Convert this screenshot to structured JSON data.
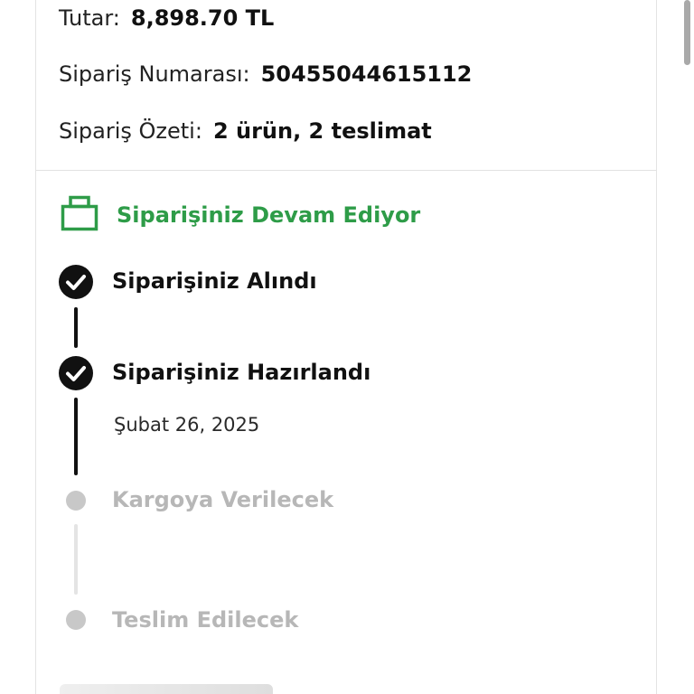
{
  "order": {
    "amount_label": "Tutar:",
    "amount_value": "8,898.70 TL",
    "number_label": "Sipariş Numarası:",
    "number_value": "50455044615112",
    "summary_label": "Sipariş Özeti:",
    "summary_value": "2 ürün, 2 teslimat"
  },
  "status": {
    "title": "Siparişiniz Devam Ediyor",
    "icon": "package-box-icon",
    "color": "#2e9c48"
  },
  "timeline": {
    "steps": [
      {
        "label": "Siparişiniz Alındı",
        "state": "done",
        "icon": "check-circle-icon"
      },
      {
        "label": "Siparişiniz Hazırlandı",
        "state": "done",
        "icon": "check-circle-icon",
        "date": "Şubat 26, 2025"
      },
      {
        "label": "Kargoya Verilecek",
        "state": "pending",
        "icon": "pending-dot-icon"
      },
      {
        "label": "Teslim Edilecek",
        "state": "pending",
        "icon": "pending-dot-icon"
      }
    ]
  },
  "colors": {
    "done": "#111111",
    "pending": "#b7b7b7",
    "accent": "#2e9c48"
  }
}
